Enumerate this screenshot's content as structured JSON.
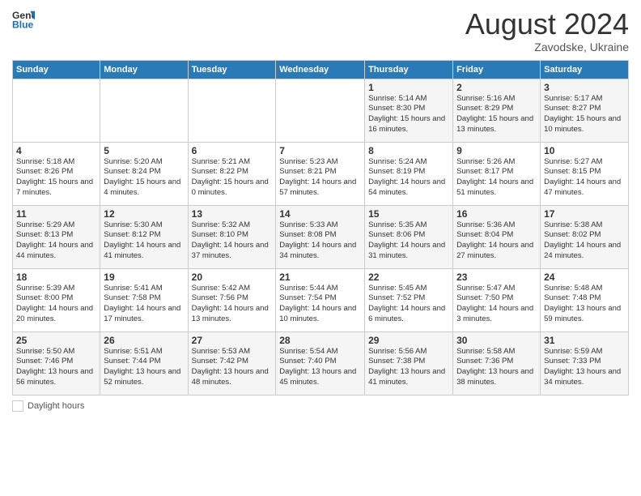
{
  "header": {
    "logo_general": "General",
    "logo_blue": "Blue",
    "month_year": "August 2024",
    "location": "Zavodske, Ukraine"
  },
  "weekdays": [
    "Sunday",
    "Monday",
    "Tuesday",
    "Wednesday",
    "Thursday",
    "Friday",
    "Saturday"
  ],
  "footer": {
    "label": "Daylight hours"
  },
  "weeks": [
    [
      {
        "day": "",
        "info": ""
      },
      {
        "day": "",
        "info": ""
      },
      {
        "day": "",
        "info": ""
      },
      {
        "day": "",
        "info": ""
      },
      {
        "day": "1",
        "info": "Sunrise: 5:14 AM\nSunset: 8:30 PM\nDaylight: 15 hours\nand 16 minutes."
      },
      {
        "day": "2",
        "info": "Sunrise: 5:16 AM\nSunset: 8:29 PM\nDaylight: 15 hours\nand 13 minutes."
      },
      {
        "day": "3",
        "info": "Sunrise: 5:17 AM\nSunset: 8:27 PM\nDaylight: 15 hours\nand 10 minutes."
      }
    ],
    [
      {
        "day": "4",
        "info": "Sunrise: 5:18 AM\nSunset: 8:26 PM\nDaylight: 15 hours\nand 7 minutes."
      },
      {
        "day": "5",
        "info": "Sunrise: 5:20 AM\nSunset: 8:24 PM\nDaylight: 15 hours\nand 4 minutes."
      },
      {
        "day": "6",
        "info": "Sunrise: 5:21 AM\nSunset: 8:22 PM\nDaylight: 15 hours\nand 0 minutes."
      },
      {
        "day": "7",
        "info": "Sunrise: 5:23 AM\nSunset: 8:21 PM\nDaylight: 14 hours\nand 57 minutes."
      },
      {
        "day": "8",
        "info": "Sunrise: 5:24 AM\nSunset: 8:19 PM\nDaylight: 14 hours\nand 54 minutes."
      },
      {
        "day": "9",
        "info": "Sunrise: 5:26 AM\nSunset: 8:17 PM\nDaylight: 14 hours\nand 51 minutes."
      },
      {
        "day": "10",
        "info": "Sunrise: 5:27 AM\nSunset: 8:15 PM\nDaylight: 14 hours\nand 47 minutes."
      }
    ],
    [
      {
        "day": "11",
        "info": "Sunrise: 5:29 AM\nSunset: 8:13 PM\nDaylight: 14 hours\nand 44 minutes."
      },
      {
        "day": "12",
        "info": "Sunrise: 5:30 AM\nSunset: 8:12 PM\nDaylight: 14 hours\nand 41 minutes."
      },
      {
        "day": "13",
        "info": "Sunrise: 5:32 AM\nSunset: 8:10 PM\nDaylight: 14 hours\nand 37 minutes."
      },
      {
        "day": "14",
        "info": "Sunrise: 5:33 AM\nSunset: 8:08 PM\nDaylight: 14 hours\nand 34 minutes."
      },
      {
        "day": "15",
        "info": "Sunrise: 5:35 AM\nSunset: 8:06 PM\nDaylight: 14 hours\nand 31 minutes."
      },
      {
        "day": "16",
        "info": "Sunrise: 5:36 AM\nSunset: 8:04 PM\nDaylight: 14 hours\nand 27 minutes."
      },
      {
        "day": "17",
        "info": "Sunrise: 5:38 AM\nSunset: 8:02 PM\nDaylight: 14 hours\nand 24 minutes."
      }
    ],
    [
      {
        "day": "18",
        "info": "Sunrise: 5:39 AM\nSunset: 8:00 PM\nDaylight: 14 hours\nand 20 minutes."
      },
      {
        "day": "19",
        "info": "Sunrise: 5:41 AM\nSunset: 7:58 PM\nDaylight: 14 hours\nand 17 minutes."
      },
      {
        "day": "20",
        "info": "Sunrise: 5:42 AM\nSunset: 7:56 PM\nDaylight: 14 hours\nand 13 minutes."
      },
      {
        "day": "21",
        "info": "Sunrise: 5:44 AM\nSunset: 7:54 PM\nDaylight: 14 hours\nand 10 minutes."
      },
      {
        "day": "22",
        "info": "Sunrise: 5:45 AM\nSunset: 7:52 PM\nDaylight: 14 hours\nand 6 minutes."
      },
      {
        "day": "23",
        "info": "Sunrise: 5:47 AM\nSunset: 7:50 PM\nDaylight: 14 hours\nand 3 minutes."
      },
      {
        "day": "24",
        "info": "Sunrise: 5:48 AM\nSunset: 7:48 PM\nDaylight: 13 hours\nand 59 minutes."
      }
    ],
    [
      {
        "day": "25",
        "info": "Sunrise: 5:50 AM\nSunset: 7:46 PM\nDaylight: 13 hours\nand 56 minutes."
      },
      {
        "day": "26",
        "info": "Sunrise: 5:51 AM\nSunset: 7:44 PM\nDaylight: 13 hours\nand 52 minutes."
      },
      {
        "day": "27",
        "info": "Sunrise: 5:53 AM\nSunset: 7:42 PM\nDaylight: 13 hours\nand 48 minutes."
      },
      {
        "day": "28",
        "info": "Sunrise: 5:54 AM\nSunset: 7:40 PM\nDaylight: 13 hours\nand 45 minutes."
      },
      {
        "day": "29",
        "info": "Sunrise: 5:56 AM\nSunset: 7:38 PM\nDaylight: 13 hours\nand 41 minutes."
      },
      {
        "day": "30",
        "info": "Sunrise: 5:58 AM\nSunset: 7:36 PM\nDaylight: 13 hours\nand 38 minutes."
      },
      {
        "day": "31",
        "info": "Sunrise: 5:59 AM\nSunset: 7:33 PM\nDaylight: 13 hours\nand 34 minutes."
      }
    ]
  ]
}
